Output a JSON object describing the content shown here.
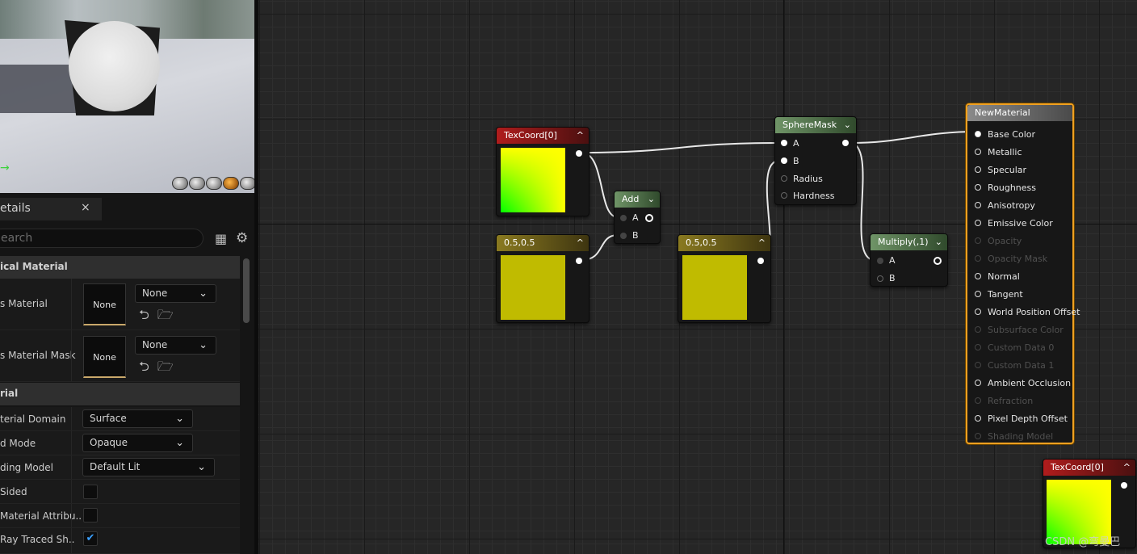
{
  "details": {
    "tab_label": "etails",
    "close": "×",
    "search_placeholder": "earch",
    "categories": {
      "physical_material": "ical Material",
      "material": "rial"
    },
    "rows": {
      "phys_material": {
        "label": "s Material",
        "thumb": "None",
        "value": "None"
      },
      "phys_material_mask": {
        "label": "s Material Mask",
        "thumb": "None",
        "value": "None"
      },
      "material_domain": {
        "label": "terial Domain",
        "value": "Surface"
      },
      "blend_mode": {
        "label": "d Mode",
        "value": "Opaque"
      },
      "shading_model": {
        "label": "ding Model",
        "value": "Default Lit"
      },
      "two_sided": {
        "label": "Sided",
        "checked": false
      },
      "material_attributes": {
        "label": "Material Attribu..",
        "checked": false
      },
      "ray_traced_shadows": {
        "label": "Ray Traced Sh..",
        "checked": true
      }
    }
  },
  "nodes": {
    "texcoord1": {
      "title": "TexCoord[0]"
    },
    "const_a": {
      "title": "0.5,0.5"
    },
    "add": {
      "title": "Add",
      "pins": [
        "A",
        "B"
      ]
    },
    "const_b": {
      "title": "0.5,0.5"
    },
    "spheremask": {
      "title": "SphereMask",
      "pins": [
        "A",
        "B",
        "Radius",
        "Hardness"
      ]
    },
    "multiply": {
      "title": "Multiply(,1)",
      "pins": [
        "A",
        "B"
      ]
    },
    "newmaterial": {
      "title": "NewMaterial",
      "pins": [
        "Base Color",
        "Metallic",
        "Specular",
        "Roughness",
        "Anisotropy",
        "Emissive Color",
        "Opacity",
        "Opacity Mask",
        "Normal",
        "Tangent",
        "World Position Offset",
        "Subsurface Color",
        "Custom Data 0",
        "Custom Data 1",
        "Ambient Occlusion",
        "Refraction",
        "Pixel Depth Offset",
        "Shading Model"
      ],
      "disabled": [
        6,
        7,
        11,
        12,
        13,
        15,
        17
      ]
    },
    "texcoord2": {
      "title": "TexCoord[0]"
    }
  },
  "watermark": "CSDN @弯曼巴"
}
